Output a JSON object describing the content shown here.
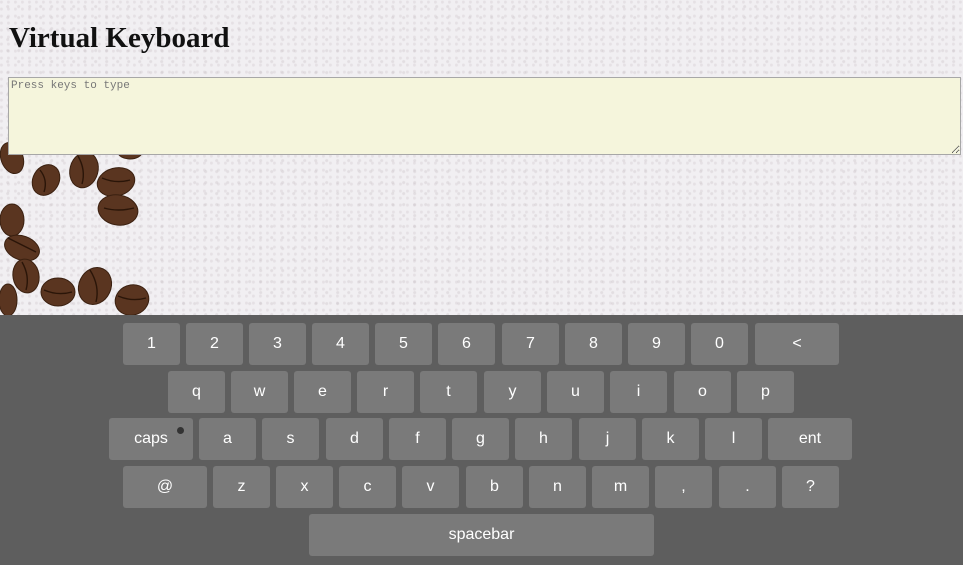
{
  "page": {
    "title": "Virtual Keyboard",
    "textarea_placeholder": "Press keys to type",
    "textarea_value": ""
  },
  "keyboard": {
    "row1": [
      "1",
      "2",
      "3",
      "4",
      "5",
      "6",
      "7",
      "8",
      "9",
      "0",
      "<"
    ],
    "row2": [
      "q",
      "w",
      "e",
      "r",
      "t",
      "y",
      "u",
      "i",
      "o",
      "p"
    ],
    "row3": [
      "caps",
      "a",
      "s",
      "d",
      "f",
      "g",
      "h",
      "j",
      "k",
      "l",
      "ent"
    ],
    "row4": [
      "@",
      "z",
      "x",
      "c",
      "v",
      "b",
      "n",
      "m",
      ",",
      ".",
      "?"
    ],
    "row5": [
      "spacebar"
    ],
    "caps_indicator": "off"
  },
  "colors": {
    "keyboard_bg": "#5e5e5e",
    "key_bg": "#7a7a7a",
    "textarea_bg": "#f5f5dc"
  }
}
